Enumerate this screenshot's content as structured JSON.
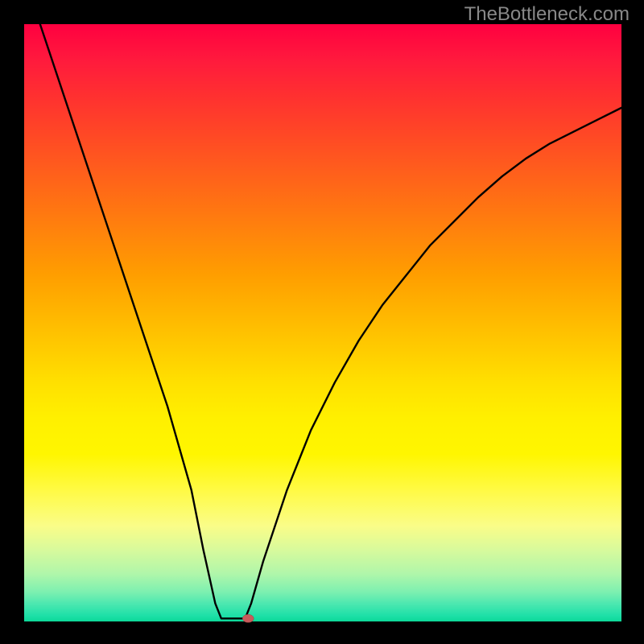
{
  "watermark": "TheBottleneck.com",
  "chart_data": {
    "type": "line",
    "title": "",
    "xlabel": "",
    "ylabel": "",
    "xlim": [
      0,
      100
    ],
    "ylim": [
      0,
      100
    ],
    "grid": false,
    "legend": false,
    "series": [
      {
        "name": "bottleneck-curve",
        "x": [
          0,
          4,
          8,
          12,
          16,
          20,
          24,
          28,
          30,
          32,
          33,
          34,
          37,
          38,
          40,
          44,
          48,
          52,
          56,
          60,
          64,
          68,
          72,
          76,
          80,
          84,
          88,
          92,
          96,
          100
        ],
        "y": [
          108,
          96,
          84,
          72,
          60,
          48,
          36,
          22,
          12,
          3,
          0.5,
          0.5,
          0.5,
          3,
          10,
          22,
          32,
          40,
          47,
          53,
          58,
          63,
          67,
          71,
          74.5,
          77.5,
          80,
          82,
          84,
          86
        ]
      }
    ],
    "marker": {
      "name": "optimal-point",
      "x": 37.5,
      "y": 0.5,
      "color": "#c75b5b",
      "rx": 7,
      "ry": 5
    },
    "gradient_stops": [
      {
        "pos": 0,
        "color": "#ff0040"
      },
      {
        "pos": 50,
        "color": "#ffca00"
      },
      {
        "pos": 80,
        "color": "#fafd88"
      },
      {
        "pos": 100,
        "color": "#0cd898"
      }
    ]
  }
}
